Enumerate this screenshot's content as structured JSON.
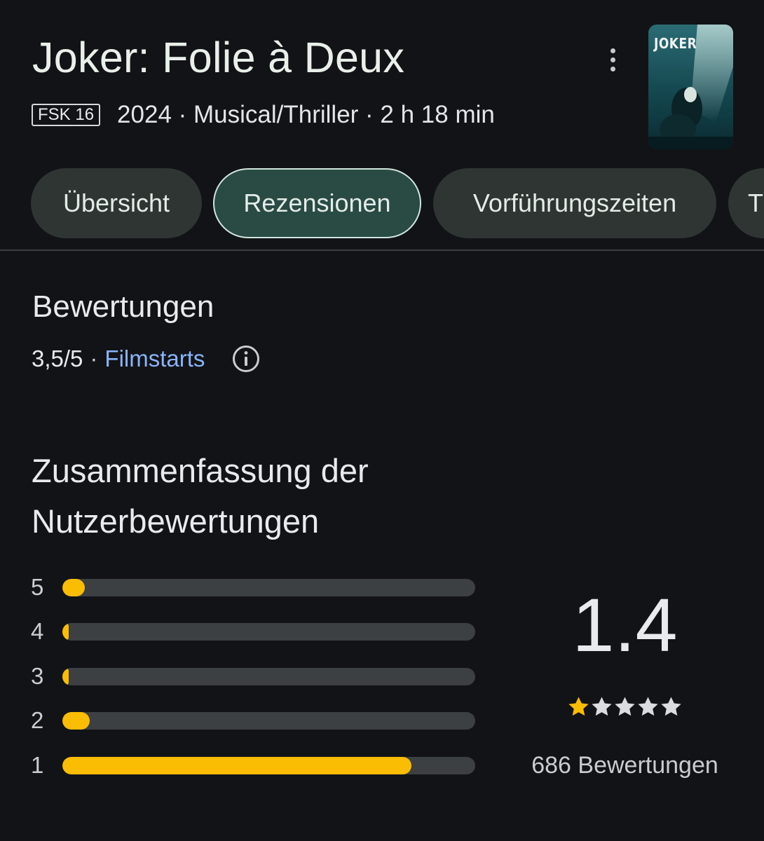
{
  "movie": {
    "title": "Joker: Folie à Deux",
    "age_rating": "FSK 16",
    "details": "2024 · Musical/Thriller · 2 h 18 min",
    "poster_word": "JOKER",
    "more_icon": "more-vert-icon"
  },
  "tabs": [
    {
      "label": "Übersicht",
      "active": false
    },
    {
      "label": "Rezensionen",
      "active": true
    },
    {
      "label": "Vorführungszeiten",
      "active": false
    },
    {
      "label": "T",
      "active": false
    }
  ],
  "ratings": {
    "heading": "Bewertungen",
    "score": "3,5/5",
    "separator": "·",
    "source": "Filmstarts",
    "info_icon": "info-icon"
  },
  "summary": {
    "heading_line1": "Zusammenfassung der",
    "heading_line2": "Nutzerbewertungen",
    "average": "1.4",
    "stars_filled": 1,
    "stars_total": 5,
    "count_label": "686 Bewertungen",
    "distribution": [
      {
        "stars": "5",
        "share": 0.055
      },
      {
        "stars": "4",
        "share": 0.015
      },
      {
        "stars": "3",
        "share": 0.015
      },
      {
        "stars": "2",
        "share": 0.067
      },
      {
        "stars": "1",
        "share": 0.845
      }
    ]
  },
  "colors": {
    "background": "#121317",
    "accent_link": "#8ab4f8",
    "bar_fill": "#fbbc04",
    "bar_track": "#3c4043",
    "active_tab": "#2a4a44",
    "star_empty": "#dadce0"
  }
}
